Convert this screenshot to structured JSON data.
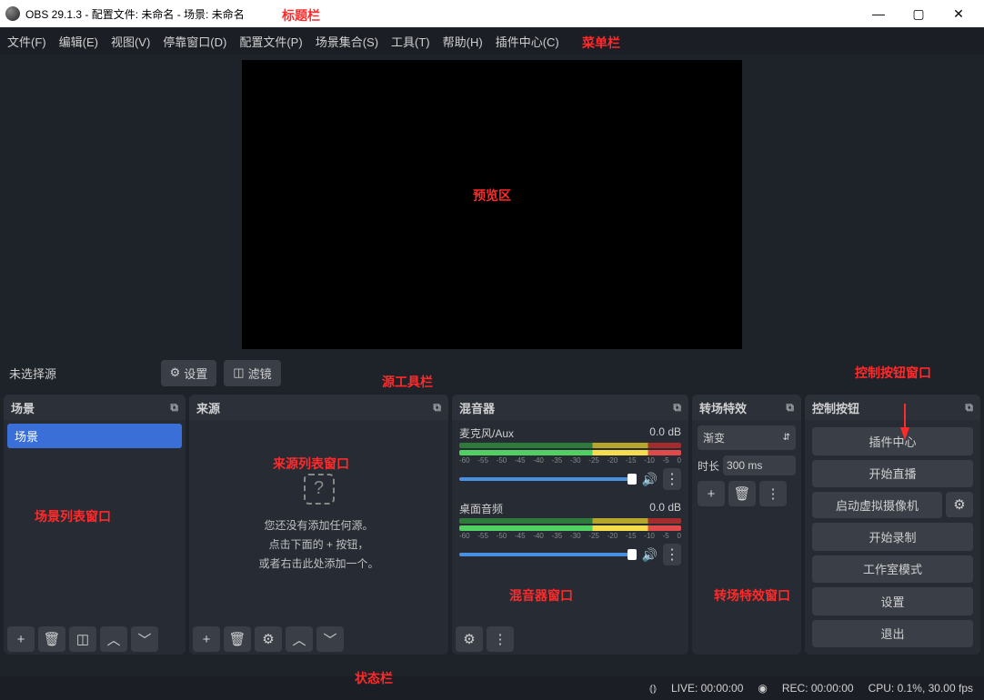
{
  "title": "OBS 29.1.3 - 配置文件: 未命名 - 场景: 未命名",
  "menu": [
    "文件(F)",
    "编辑(E)",
    "视图(V)",
    "停靠窗口(D)",
    "配置文件(P)",
    "场景集合(S)",
    "工具(T)",
    "帮助(H)",
    "插件中心(C)"
  ],
  "srcToolbar": {
    "noSource": "未选择源",
    "settings": "设置",
    "filters": "滤镜"
  },
  "panels": {
    "scenes": {
      "title": "场景",
      "item": "场景"
    },
    "sources": {
      "title": "来源",
      "empty1": "您还没有添加任何源。",
      "empty2": "点击下面的 + 按钮，",
      "empty3": "或者右击此处添加一个。"
    },
    "mixer": {
      "title": "混音器",
      "ch1": {
        "name": "麦克风/Aux",
        "db": "0.0 dB"
      },
      "ch2": {
        "name": "桌面音频",
        "db": "0.0 dB"
      },
      "ticks": [
        "-60",
        "-55",
        "-50",
        "-45",
        "-40",
        "-35",
        "-30",
        "-25",
        "-20",
        "-15",
        "-10",
        "-5",
        "0"
      ]
    },
    "trans": {
      "title": "转场特效",
      "type": "渐变",
      "durLabel": "时长",
      "dur": "300 ms"
    },
    "ctrl": {
      "title": "控制按钮",
      "btns": [
        "插件中心",
        "开始直播",
        "启动虚拟摄像机",
        "开始录制",
        "工作室模式",
        "设置",
        "退出"
      ]
    }
  },
  "status": {
    "live": "LIVE: 00:00:00",
    "rec": "REC: 00:00:00",
    "cpu": "CPU: 0.1%, 30.00 fps"
  },
  "anno": {
    "title": "标题栏",
    "menu": "菜单栏",
    "preview": "预览区",
    "srcTool": "源工具栏",
    "ctrlWin": "控制按钮窗口",
    "sources": "来源列表窗口",
    "scenes": "场景列表窗口",
    "mixer": "混音器窗口",
    "trans": "转场特效窗口",
    "status": "状态栏"
  }
}
